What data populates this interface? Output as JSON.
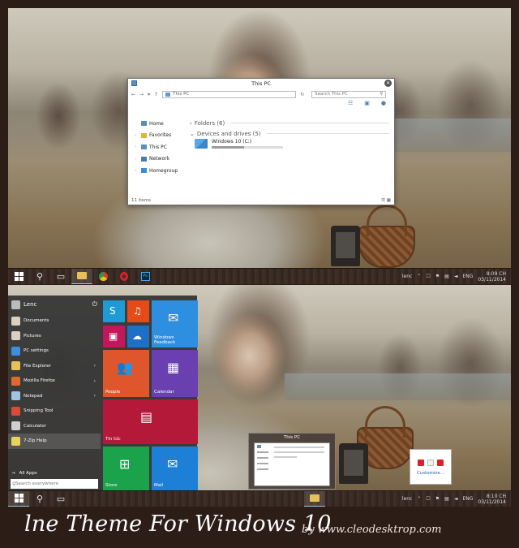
{
  "explorer": {
    "title": "This PC",
    "address": "This PC",
    "search_placeholder": "Search This PC",
    "sidebar": [
      {
        "label": "Home",
        "color": "#5a8ec0"
      },
      {
        "label": "Favorites",
        "color": "#e0b33a"
      },
      {
        "label": "This PC",
        "color": "#5a8ec0"
      },
      {
        "label": "Network",
        "color": "#4a7ab0"
      },
      {
        "label": "Homegroup",
        "color": "#3b8ed6"
      }
    ],
    "folders_label": "Folders (6)",
    "devices_label": "Devices and drives (5)",
    "drive_label": "Windows 10 (C:)",
    "drive_used_fraction": 0.45,
    "status": "11 items"
  },
  "taskbar1": {
    "user": "lenc",
    "lang": "ENG",
    "time": "8:09 CH",
    "date": "03/11/2014"
  },
  "taskbar2": {
    "user": "lenc",
    "lang": "ENG",
    "time": "8:10 CH",
    "date": "03/11/2014"
  },
  "start": {
    "user": "Lenc",
    "items": [
      {
        "label": "Documents",
        "color": "#d9d0bf",
        "arrow": false
      },
      {
        "label": "Pictures",
        "color": "#d9d0bf",
        "arrow": false
      },
      {
        "label": "PC settings",
        "color": "#3d8de0",
        "arrow": false
      },
      {
        "label": "File Explorer",
        "color": "#e8c05a",
        "arrow": true
      },
      {
        "label": "Mozilla Firefox",
        "color": "#e06a2a",
        "arrow": true
      },
      {
        "label": "Notepad",
        "color": "#9fc3e0",
        "arrow": true
      },
      {
        "label": "Snipping Tool",
        "color": "#d84a3a",
        "arrow": false
      },
      {
        "label": "Calculator",
        "color": "#cfcfcf",
        "arrow": false
      },
      {
        "label": "7-Zip Help",
        "color": "#e8d45a",
        "arrow": false
      }
    ],
    "all_apps": "All Apps",
    "search_placeholder": "Search everywhere",
    "tiles": {
      "feedback": "Windows Feedback",
      "people": "People",
      "calendar": "Calendar",
      "news": "Tin tức",
      "store": "Store",
      "mail": "Mail"
    }
  },
  "thumbnail": {
    "title": "This PC"
  },
  "tray_popup": {
    "customize": "Customize..."
  },
  "caption": {
    "title": "lne Theme For Windows 10",
    "byline": "by www.cleodesktrop.com"
  }
}
